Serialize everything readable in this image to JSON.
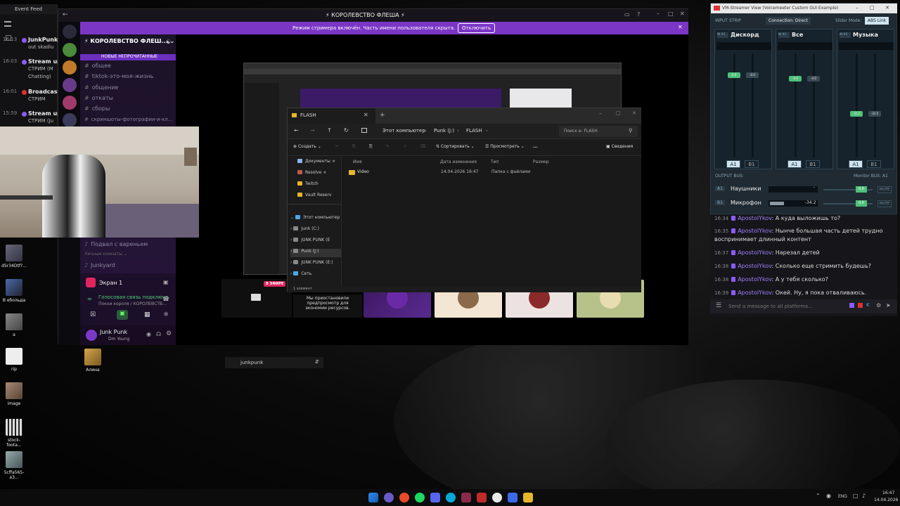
{
  "event_feed": {
    "title": "Event Feed",
    "items": [
      {
        "time": "16:13",
        "name": "JunkPunk",
        "sub": "out skadiu",
        "color": "#8a5cf6"
      },
      {
        "time": "16:03",
        "name": "Stream up",
        "sub": "СТРИМ (М",
        "sub2": "Chatting)",
        "color": "#8a5cf6"
      },
      {
        "time": "16:01",
        "name": "Broadcast",
        "sub": "СТРИМ",
        "color": "#e03030"
      },
      {
        "time": "15:59",
        "name": "Stream up",
        "sub": "СТРИМ (Ju",
        "color": "#8a5cf6"
      }
    ]
  },
  "discord": {
    "window_title": "КОРОЛЕВСТВО ФЛЕША",
    "banner_text": "Режим стримера включён. Часть имени пользователя скрыта.",
    "banner_button": "Отключить",
    "server_name": "КОРОЛЕВСТВО ФЛЕШ...",
    "new_unread": "НОВЫЕ НЕПРОЧИТАННЫЕ",
    "channels": [
      "общее",
      "tiktok-это-моя-жизнь",
      "общение",
      "откаты",
      "сборы",
      "скриншоты-фотографии-и-кл..."
    ],
    "voice_channels": [
      "Подвал с вареньем",
      "Junkyard"
    ],
    "private_room": "Личные комнаты",
    "screen_label": "Экран 1",
    "voice_status": "Голосовая связь подключе",
    "voice_sub": "Покои короля / КОРОЛЕВСТВ...",
    "user_name": "Junk Punk",
    "user_status": "Dm Young",
    "live_badge": "В ЭФИРЕ",
    "paused_text": "Мы приостановили предпросмотр для экономии ресурсов.",
    "bottom_field": "junkpunk"
  },
  "explorer": {
    "tab_title": "FLASH",
    "breadcrumb": [
      "Этот компьютер",
      "Punk (J:)",
      "FLASH"
    ],
    "search_placeholder": "Поиск в: FLASH",
    "toolbar": {
      "create": "Создать",
      "sort": "Сортировать",
      "view": "Просмотреть",
      "more": "...",
      "details": "Сведения"
    },
    "nav": [
      {
        "label": "Документы",
        "pinned": true
      },
      {
        "label": "Resolve",
        "pinned": true
      },
      {
        "label": "Twitch",
        "pinned": false
      },
      {
        "label": "Vault Reserv",
        "pinned": false
      }
    ],
    "nav_tree": [
      "Этот компьютер",
      "Junk (C:)",
      "JUNK PUNK (E",
      "Punk (J:)",
      "JUNK PUNK (E:)",
      "Сеть"
    ],
    "columns": [
      "Имя",
      "Дата изменения",
      "Тип",
      "Размер"
    ],
    "rows": [
      {
        "name": "Video",
        "date": "14.04.2026 16:47",
        "type": "Папка с файлами",
        "size": ""
      }
    ],
    "status": "1 элемент"
  },
  "voicemeeter": {
    "title": "VM-Streamer View (Voicemeeter Custom GUI Example)",
    "input_strip_label": "INPUT STRIP",
    "connection": "Connection: Direct",
    "slider_mode_label": "Slider Mode:",
    "slider_mode": "ABS Link",
    "strips": [
      {
        "name": "Дискорд",
        "tag": "IN #1",
        "gain_a": "0.0",
        "gain_b": "-0.0",
        "level": 0.79,
        "a1": "A1",
        "b1": "B1"
      },
      {
        "name": "Все",
        "tag": "IN #1",
        "gain_a": "-4.0",
        "gain_b": "-4.0",
        "level": 0.76,
        "a1": "A1",
        "b1": "B1"
      },
      {
        "name": "Музыка",
        "tag": "IN #3",
        "gain_a": "-31.5",
        "gain_b": "-31.5",
        "level": 0.42,
        "a1": "A1",
        "b1": "B1"
      }
    ],
    "output_bus_label": "OUTPUT BUS:",
    "monitor_bus": "Monitor BUS: A1",
    "outputs": [
      {
        "tag": "A1",
        "name": "Наушники",
        "level": "-",
        "gain": "0.0",
        "mute": "MUTE"
      },
      {
        "tag": "B1",
        "name": "Микрофон",
        "level": "-34.2",
        "gain": "0.0",
        "mute": "MUTE"
      }
    ]
  },
  "chat": {
    "messages": [
      {
        "time": "16:34",
        "user": "ApostolYkov",
        "text": "А куда выложишь то?"
      },
      {
        "time": "16:35",
        "user": "ApostolYkov",
        "text": "Нынче большая часть детей трудно",
        "text2": "воспринимает длинный контент"
      },
      {
        "time": "16:37",
        "user": "ApostolYkov",
        "text": "Нарезал детей"
      },
      {
        "time": "16:38",
        "user": "ApostolYkov",
        "text": "Сколько еще стримить будешь?"
      },
      {
        "time": "16:38",
        "user": "ApostolYkov",
        "text": "А у тебя сколько?"
      },
      {
        "time": "16:39",
        "user": "ApostolYkov",
        "text": "Окей. Ну, я пока отваливаюсь."
      }
    ],
    "input_placeholder": "Send a message to all platforms..."
  },
  "desktop_icons": [
    "d5r34Dtf?...",
    "В ебольда",
    "a",
    "rip",
    "image",
    "stock-foota...",
    "5cffa565-a3...",
    "Алина"
  ],
  "taskbar": {
    "lang": "ENG",
    "time": "16:47",
    "date": "14.04.2026"
  }
}
